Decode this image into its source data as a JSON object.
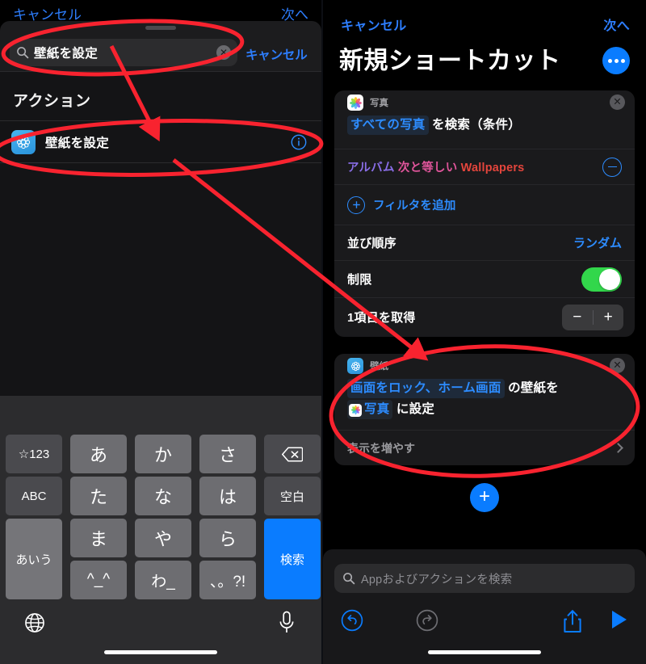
{
  "left_panel": {
    "behind_cancel": "キャンセル",
    "behind_next": "次へ",
    "search": {
      "value": "壁紙を設定",
      "icon": "search-icon",
      "clear_icon": "clear-circle-icon"
    },
    "cancel_label": "キャンセル",
    "section_header": "アクション",
    "action_result": {
      "label": "壁紙を設定",
      "icon": "wallpaper-app-icon",
      "info_icon": "info-circle-icon"
    },
    "keyboard": {
      "rows": [
        [
          {
            "label": "☆123",
            "style": "dk"
          },
          {
            "label": "あ",
            "style": "lt"
          },
          {
            "label": "か",
            "style": "lt"
          },
          {
            "label": "さ",
            "style": "lt"
          },
          {
            "label": "⌫",
            "style": "dk",
            "icon": "backspace-icon"
          }
        ],
        [
          {
            "label": "ABC",
            "style": "dk"
          },
          {
            "label": "た",
            "style": "lt"
          },
          {
            "label": "な",
            "style": "lt"
          },
          {
            "label": "は",
            "style": "lt"
          },
          {
            "label": "空白",
            "style": "dk"
          }
        ],
        [
          {
            "label": "あいう",
            "style": "mid"
          },
          {
            "label": "ま",
            "style": "lt"
          },
          {
            "label": "や",
            "style": "lt"
          },
          {
            "label": "ら",
            "style": "lt"
          },
          {
            "label": "検索",
            "style": "blue"
          }
        ],
        [
          {
            "label": "^_^",
            "style": "lt"
          },
          {
            "label": "わ_",
            "style": "lt"
          },
          {
            "label": "、。?!",
            "style": "lt"
          }
        ]
      ],
      "globe_icon": "globe-icon",
      "mic_icon": "microphone-icon",
      "search_key_color": "#0a7cff"
    }
  },
  "right_panel": {
    "cancel_label": "キャンセル",
    "next_label": "次へ",
    "title": "新規ショートカット",
    "more_icon": "ellipsis-icon",
    "cards": [
      {
        "app_label": "写真",
        "app_icon": "photos-app-icon",
        "close_icon": "close-circle-icon",
        "phrase_token": "すべての写真",
        "phrase_rest": "を検索（条件）",
        "filter": {
          "field": "アルバム",
          "operator": "次と等しい",
          "value": "Wallpapers",
          "remove_icon": "minus-circle-icon"
        },
        "add_filter_label": "フィルタを追加",
        "add_filter_icon": "plus-circle-icon",
        "rows": [
          {
            "label": "並び順序",
            "value": "ランダム",
            "control": "value"
          },
          {
            "label": "制限",
            "control": "toggle",
            "toggle_on": true
          },
          {
            "label": "1項目を取得",
            "control": "stepper",
            "minus": "−",
            "plus": "+"
          }
        ]
      },
      {
        "app_label": "壁紙",
        "app_icon": "wallpaper-app-icon",
        "close_icon": "close-circle-icon",
        "phrase_token_1": "画面をロック、ホーム画面",
        "phrase_mid": "の壁紙を",
        "phrase_token_2": "写真",
        "phrase_end": "に設定",
        "show_more_label": "表示を増やす",
        "chevron_icon": "chevron-right-icon"
      }
    ],
    "add_button_icon": "plus-icon",
    "search": {
      "placeholder": "Appおよびアクションを検索",
      "icon": "search-icon"
    },
    "toolbar": [
      {
        "name": "undo",
        "icon": "undo-icon",
        "color": "#0a7cff"
      },
      {
        "name": "redo",
        "icon": "redo-icon",
        "color": "#6e6e73"
      },
      {
        "name": "share",
        "icon": "share-icon",
        "color": "#0a7cff"
      },
      {
        "name": "run",
        "icon": "play-icon",
        "color": "#0a7cff"
      }
    ]
  },
  "annotations": {
    "color": "#f8232f",
    "shapes": [
      "ellipse-search-field",
      "ellipse-action-result",
      "ellipse-wallpaper-card",
      "arrow-search-to-action",
      "arrow-action-to-card"
    ]
  },
  "colors": {
    "accent_blue": "#0a7cff",
    "link_blue": "#2d8cff",
    "toggle_green": "#32d74b",
    "annotation_red": "#f8232f",
    "filter_field": "#8a6ee8",
    "filter_op": "#e0559b",
    "filter_value": "#e3453c"
  }
}
